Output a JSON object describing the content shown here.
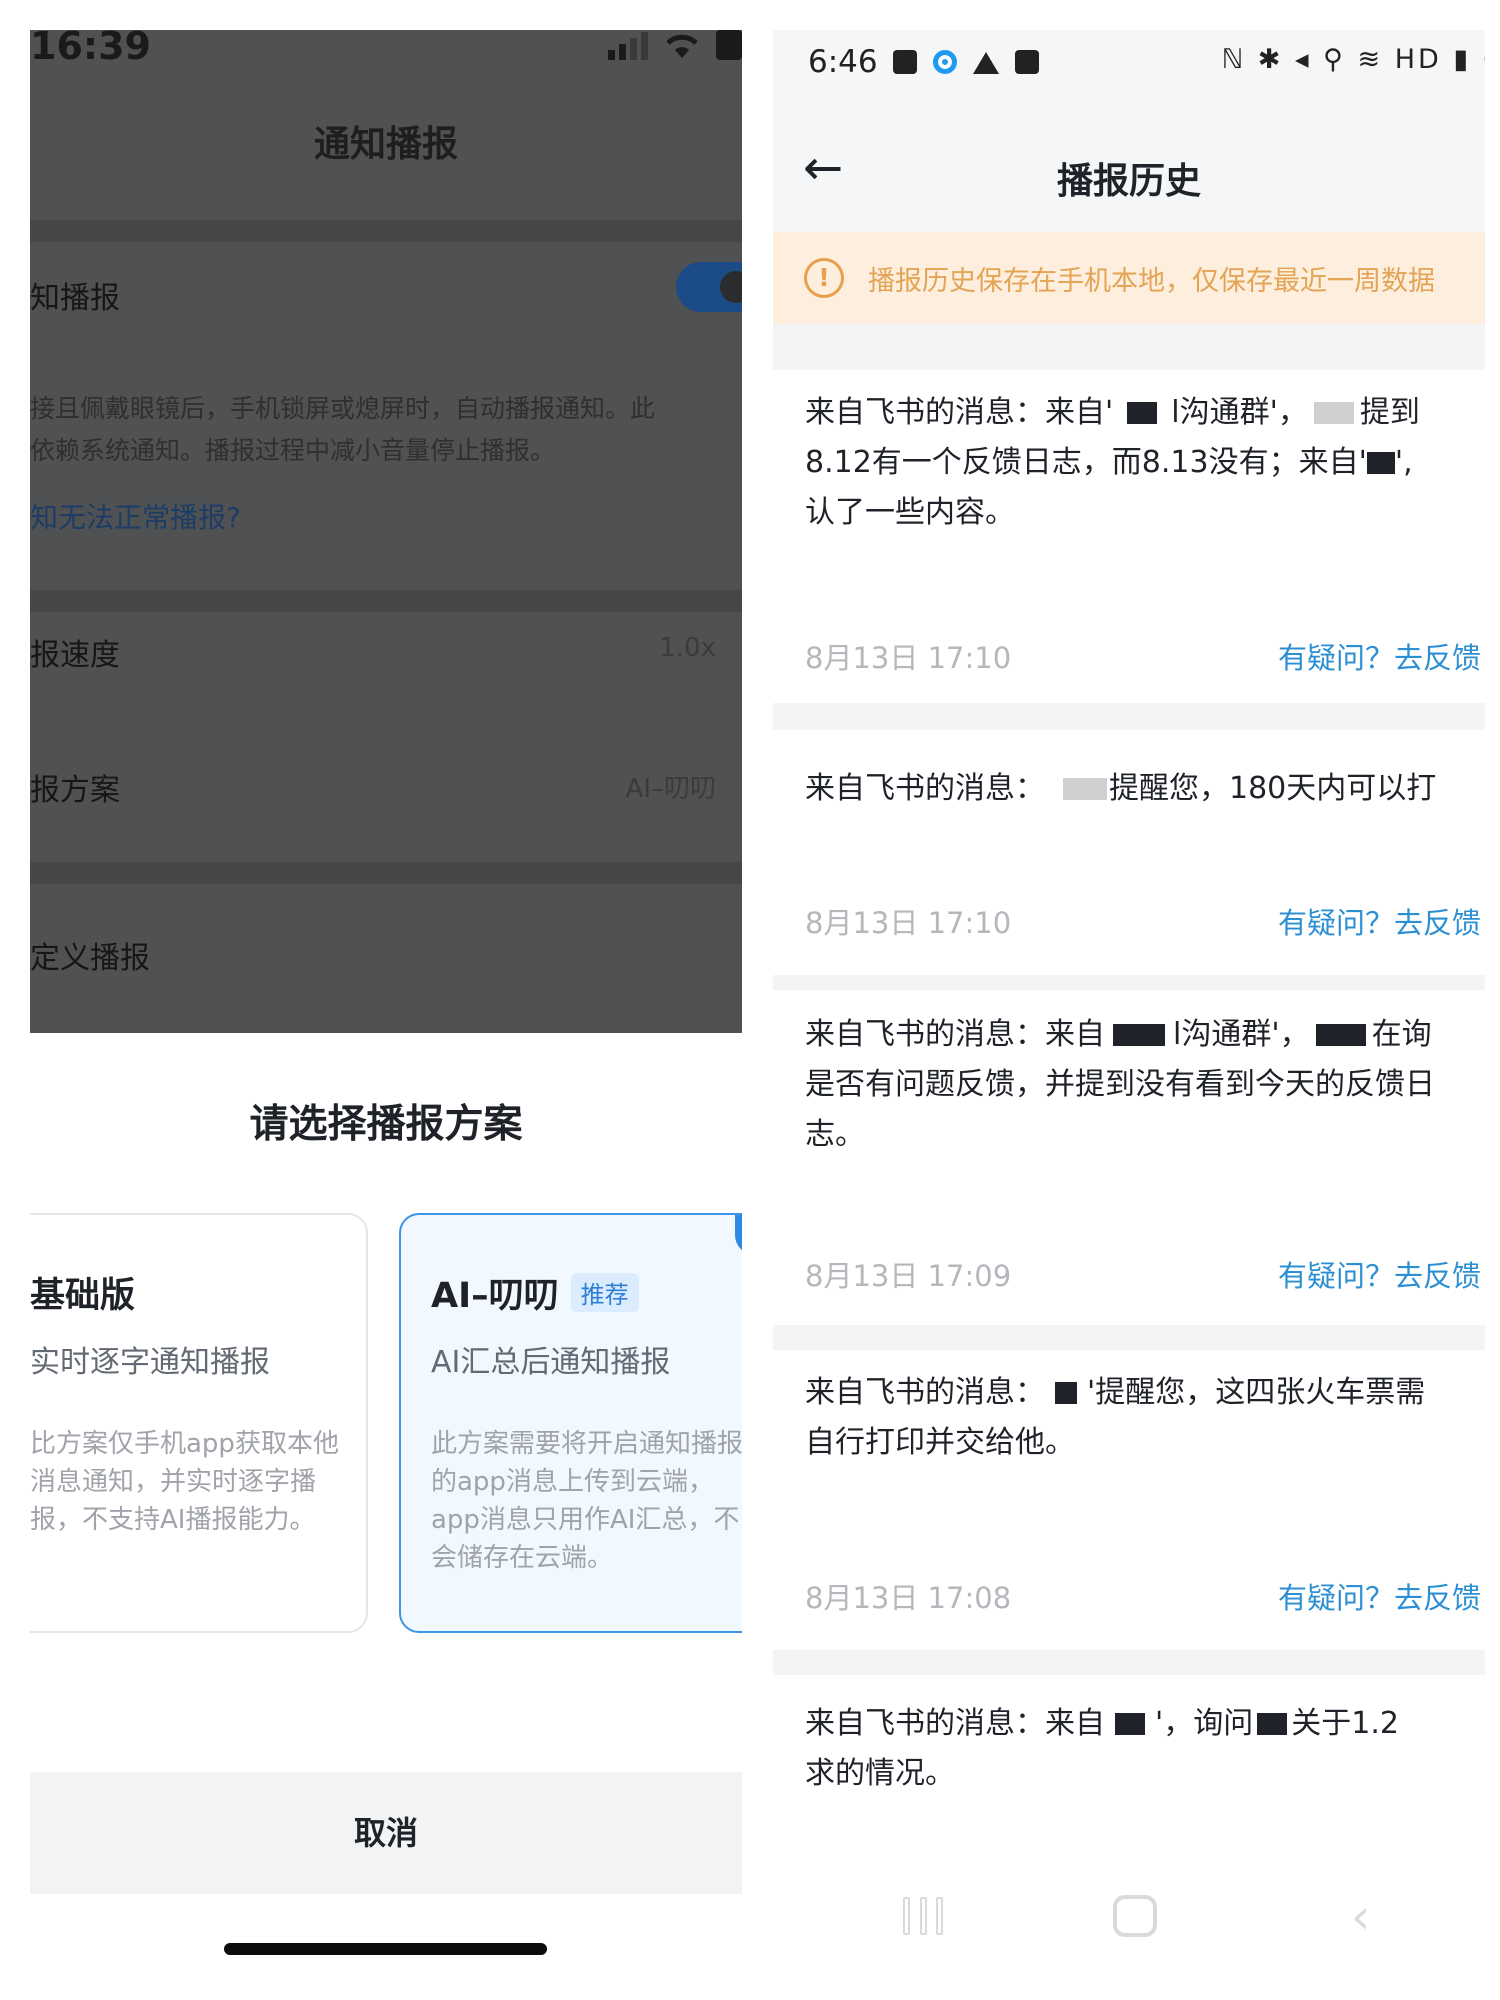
{
  "left": {
    "status_time": "16:39",
    "page_title": "通知播报",
    "rows": {
      "notify_label": "知播报",
      "notify_desc_line1": "接且佩戴眼镜后，手机锁屏或熄屏时，自动播报通知。此",
      "notify_desc_line2": "依赖系统通知。播报过程中减小音量停止播报。",
      "trouble_link": "知无法正常播报?",
      "speed_label": "报速度",
      "speed_value": "1.0x",
      "plan_label": "报方案",
      "plan_value": "AI–叨叨",
      "custom_label": "定义播报"
    },
    "sheet": {
      "title": "请选择播报方案",
      "basic": {
        "name": "基础版",
        "subtitle": "实时逐字通知播报",
        "desc": "比方案仅手机app获取本他消息通知，并实时逐字播报，不支持AI播报能力。"
      },
      "ai": {
        "name": "AI–叨叨",
        "tag": "推荐",
        "subtitle": "AI汇总后通知播报",
        "desc": "此方案需要将开启通知播报的app消息上传到云端，app消息只用作AI汇总，不会储存在云端。"
      },
      "cancel": "取消"
    }
  },
  "right": {
    "status_time": "6:46",
    "status_right": "ℕ ✱ ◂ ⚲ ≋ HD ▮ 6",
    "title": "播报历史",
    "back_glyph": "←",
    "banner_icon": "!",
    "banner": "播报历史保存在手机本地，仅保存最近一周数据",
    "messages": [
      {
        "line1_a": "来自飞书的消息：来自'",
        "line1_b": "l沟通群'，",
        "line1_c": "提到",
        "line2": "8.12有一个反馈日志，而8.13没有；来自'",
        "line2_end": "',",
        "line3": "认了一些内容。",
        "time": "8月13日 17:10",
        "feedback": "有疑问？去反馈"
      },
      {
        "line1_a": "来自飞书的消息：",
        "line1_b": "提醒您，180天内可以打",
        "time": "8月13日 17:10",
        "feedback": "有疑问？去反馈"
      },
      {
        "line1_a": "来自飞书的消息：来自",
        "line1_b": "l沟通群'，",
        "line1_c": "在询",
        "line2": "是否有问题反馈，并提到没有看到今天的反馈日",
        "line3": "志。",
        "time": "8月13日 17:09",
        "feedback": "有疑问？去反馈"
      },
      {
        "line1_a": "来自飞书的消息：",
        "line1_b": "'提醒您，这四张火车票需",
        "line2": "自行打印并交给他。",
        "time": "8月13日 17:08",
        "feedback": "有疑问？去反馈"
      },
      {
        "line1_a": "来自飞书的消息：来自",
        "line1_b": "'，询问",
        "line1_c": "关于1.2",
        "line2": "求的情况。"
      }
    ]
  }
}
